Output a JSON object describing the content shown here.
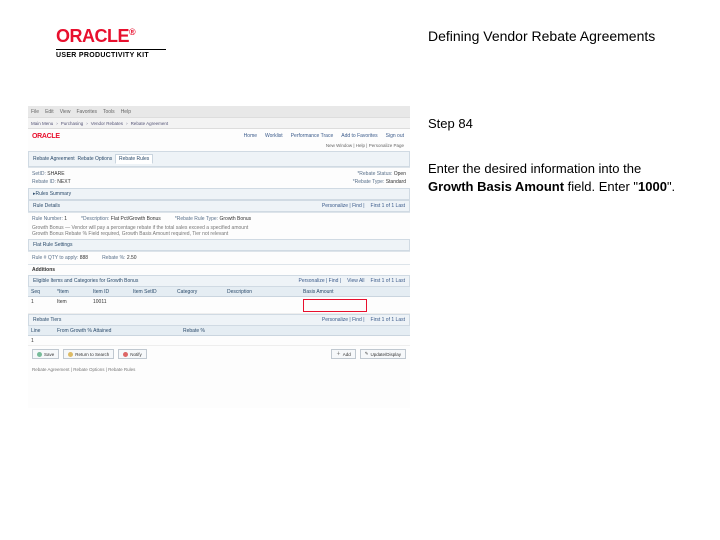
{
  "header": {
    "brand": "ORACLE",
    "reg": "®",
    "upk": "USER PRODUCTIVITY KIT",
    "title": "Defining Vendor Rebate Agreements"
  },
  "step": {
    "label": "Step 84"
  },
  "instruction": {
    "lead": "Enter the desired information into the ",
    "field": "Growth Basis Amount",
    "mid": " field. Enter \"",
    "value": "1000",
    "tail": "\"."
  },
  "screenshot": {
    "menu": {
      "a": "File",
      "b": "Edit",
      "c": "View",
      "d": "Favorites",
      "e": "Tools",
      "f": "Help"
    },
    "crumb": {
      "a": "Main Menu",
      "b": "Purchasing",
      "c": "Vendor Rebates",
      "d": "Rebate Agreement"
    },
    "brand_small": "ORACLE",
    "tabs": {
      "a": "Home",
      "b": "Worklist",
      "c": "Performance Trace",
      "d": "Add to Favorites",
      "e": "Sign out"
    },
    "global": "New Window | Help | Personalize Page",
    "pgtabs": {
      "a": "Rebate Agreement",
      "b": "Rebate Options",
      "c": "Rebate Rules"
    },
    "info": {
      "setid_lbl": "SetID:",
      "setid": "SHARE",
      "status_lbl": "*Rebate Status:",
      "status": "Open",
      "rid_lbl": "Rebate ID:",
      "rid": "NEXT",
      "rtype_lbl": "*Rebate Type:",
      "rtype": "Standard"
    },
    "rules_summary_title": "Rules Summary",
    "rules_details_title": "Rule Details",
    "rule_row": {
      "rn_lbl": "Rule Number:",
      "rn": "1",
      "desc_lbl": "*Description:",
      "desc": "Flat Pct/Growth Bonus",
      "rrt_lbl": "*Rebate Rule Type:",
      "rrt": "Growth Bonus"
    },
    "ruledesc_a": "Growth Bonus — Vendor will pay a percentage rebate if the total sales exceed a specified amount",
    "ruledesc_b": "Growth Bonus Rebate % Field required, Growth Basis Amount required, Tier not relevant",
    "flat_title": "Flat Rule Settings",
    "flat_row": {
      "a_lbl": "Rule # QTY to apply:",
      "a": "888",
      "b_lbl": "Rebate %:",
      "b": "2.50"
    },
    "add_title": "Additions",
    "add_sub": "Eligible Items and Categories for Growth Bonus",
    "thead": {
      "c1": "Seq",
      "c2": "*Item",
      "c3": "Item ID",
      "c4": "Item SetID",
      "c5": "Category",
      "c6": "Description",
      "c7": "Basis Amount"
    },
    "trow": {
      "c1": "1",
      "c2": "Item",
      "c3": "10011",
      "c4": "",
      "c5": "",
      "c6": "",
      "c7": ""
    },
    "listnav": {
      "p": "Personalize | Find |",
      "v": "View All",
      "r": "First 1 of 1 Last"
    },
    "tiers_title": "Rebate Tiers",
    "tiers_head": {
      "a": "Line",
      "b": "From Growth % Attained",
      "c": "Rebate %"
    },
    "tiers_row": {
      "a": "1",
      "b": "",
      "c": ""
    },
    "buttons": {
      "save": "Save",
      "ret": "Return to Search",
      "not": "Notify",
      "add": "Add",
      "upd": "Update/Display"
    },
    "footnote": "Rebate Agreement | Rebate Options | Rebate Rules"
  }
}
